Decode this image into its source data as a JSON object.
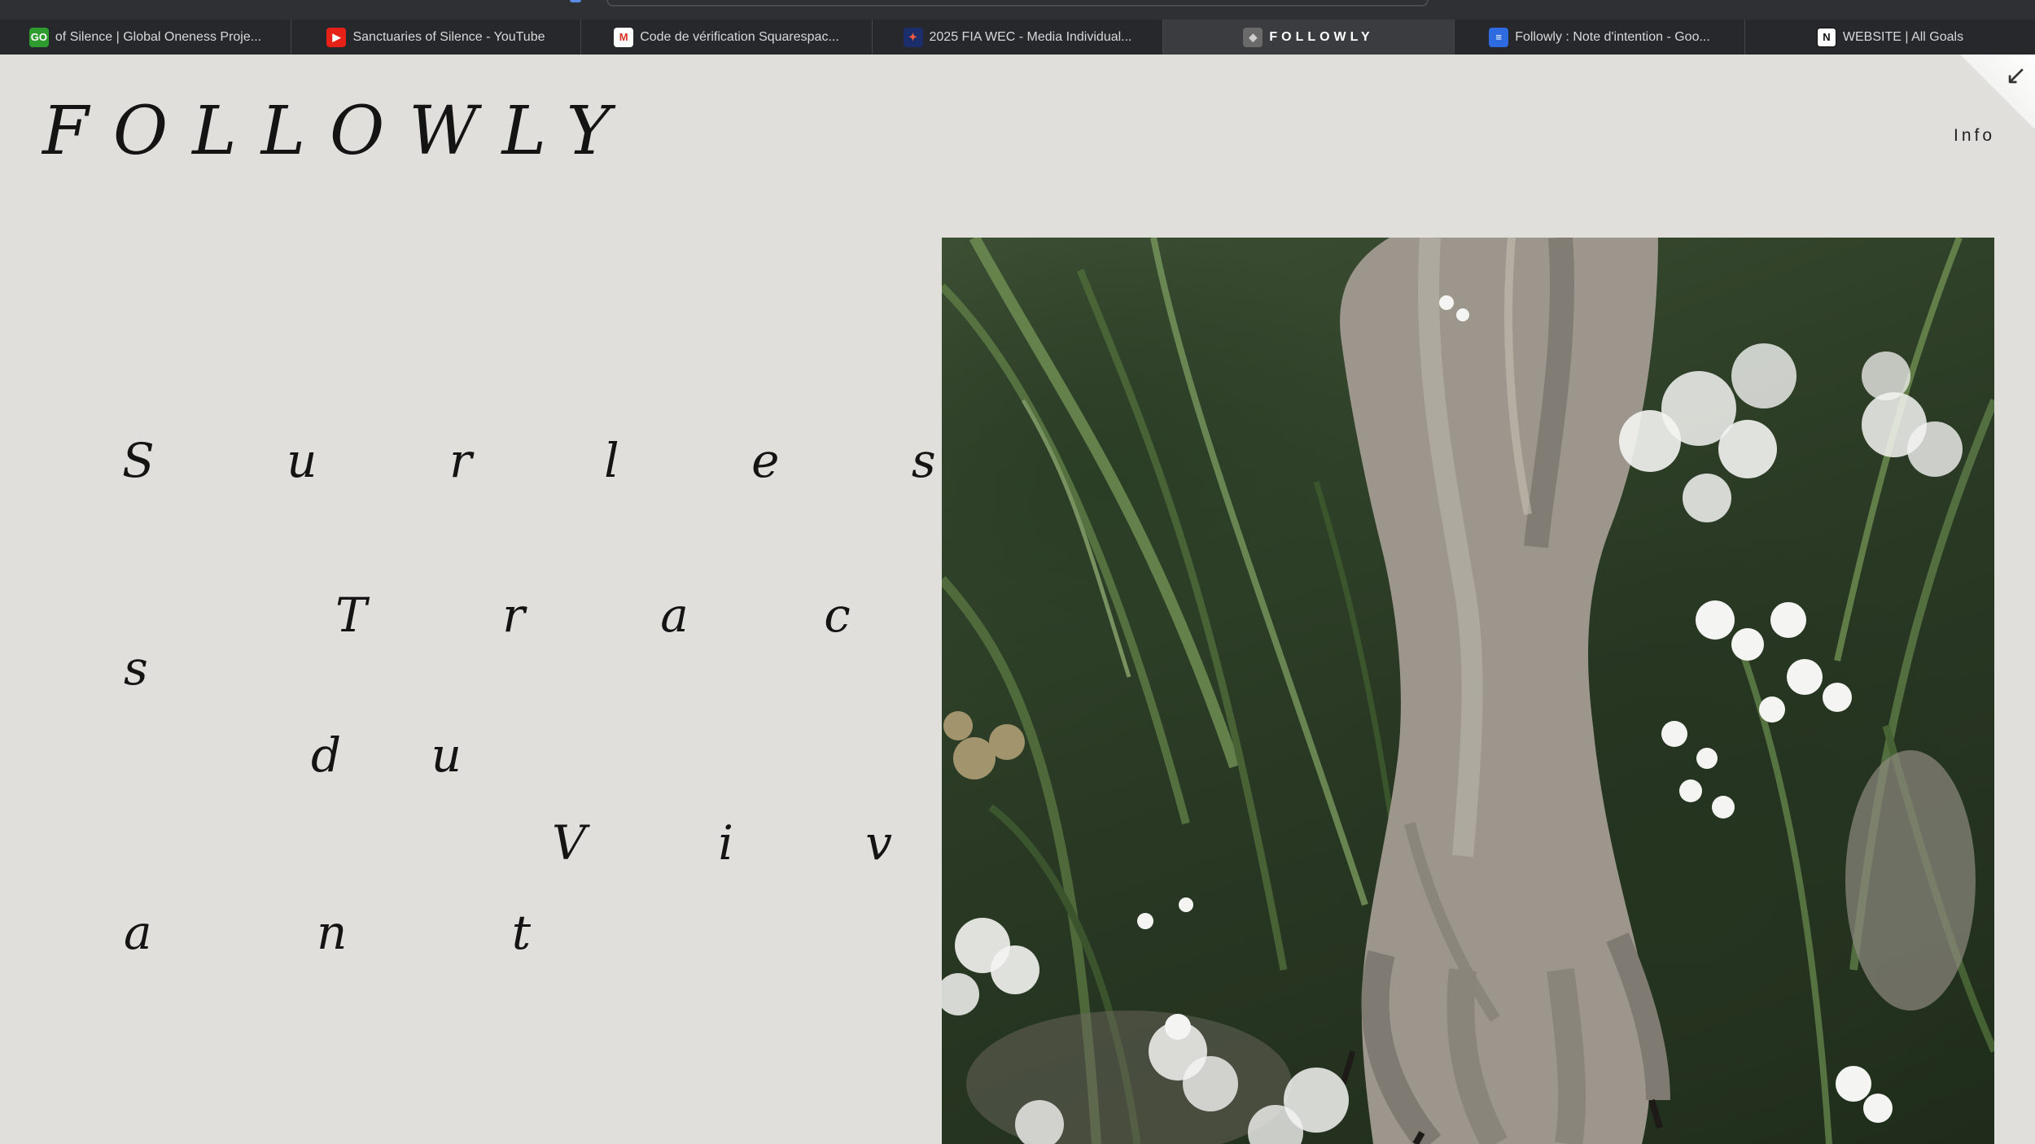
{
  "browser": {
    "tabs": [
      {
        "label": "of Silence | Global Oneness Proje...",
        "icon": "oneness-favicon",
        "color": "#2e9b2e",
        "glyph": "GO",
        "active": false
      },
      {
        "label": "Sanctuaries of Silence - YouTube",
        "icon": "youtube-favicon",
        "color": "#e62117",
        "glyph": "▶",
        "active": false
      },
      {
        "label": "Code de vérification Squarespac...",
        "icon": "gmail-favicon",
        "color": "#ffffff",
        "glyph": "M",
        "active": false
      },
      {
        "label": "2025 FIA WEC - Media Individual...",
        "icon": "fia-favicon",
        "color": "#1b2d6b",
        "glyph": "✦",
        "active": false
      },
      {
        "label": "FOLLOWLY",
        "icon": "site-favicon",
        "color": "#6a6a6a",
        "glyph": "◆",
        "active": true
      },
      {
        "label": "Followly : Note d'intention - Goo...",
        "icon": "google-docs-favicon",
        "color": "#2f6be0",
        "glyph": "≡",
        "active": false
      },
      {
        "label": "WEBSITE | All Goals",
        "icon": "notion-favicon",
        "color": "#ffffff",
        "glyph": "N",
        "active": false
      }
    ]
  },
  "site": {
    "logo": "FOLLOWLY",
    "nav": {
      "info_label": "Info"
    },
    "hero_lines": [
      "S u r   l e s",
      "T r a c e",
      "s",
      "d u",
      "V i v",
      "a n t"
    ]
  },
  "photo": {
    "subject": "wolf-paw-among-grass-and-white-flowers-photo"
  }
}
